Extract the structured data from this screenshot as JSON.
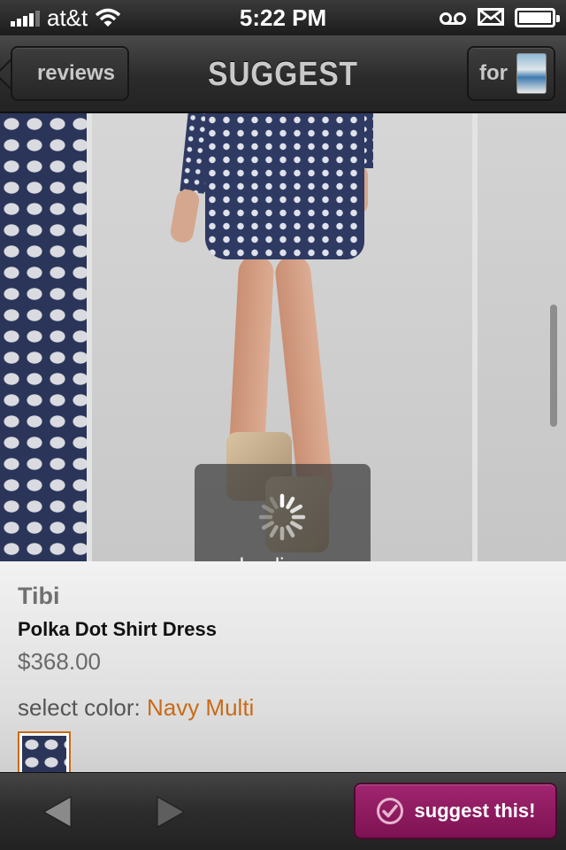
{
  "status_bar": {
    "carrier": "at&t",
    "time": "5:22 PM",
    "icons": [
      "signal-icon",
      "wifi-icon",
      "voicemail-icon",
      "mail-icon",
      "battery-icon"
    ]
  },
  "nav_bar": {
    "back_label": "reviews",
    "title": "SUGGEST",
    "for_label": "for"
  },
  "carousel": {
    "loading_text": "loading..."
  },
  "product": {
    "brand": "Tibi",
    "name": "Polka Dot Shirt Dress",
    "price": "$368.00",
    "color_label": "select color:",
    "color_value": "Navy Multi"
  },
  "toolbar": {
    "suggest_label": "suggest this!"
  },
  "colors": {
    "accent_orange": "#c96a17",
    "suggest_button": "#8f1a60",
    "bar_dark": "#2b2b2b"
  }
}
